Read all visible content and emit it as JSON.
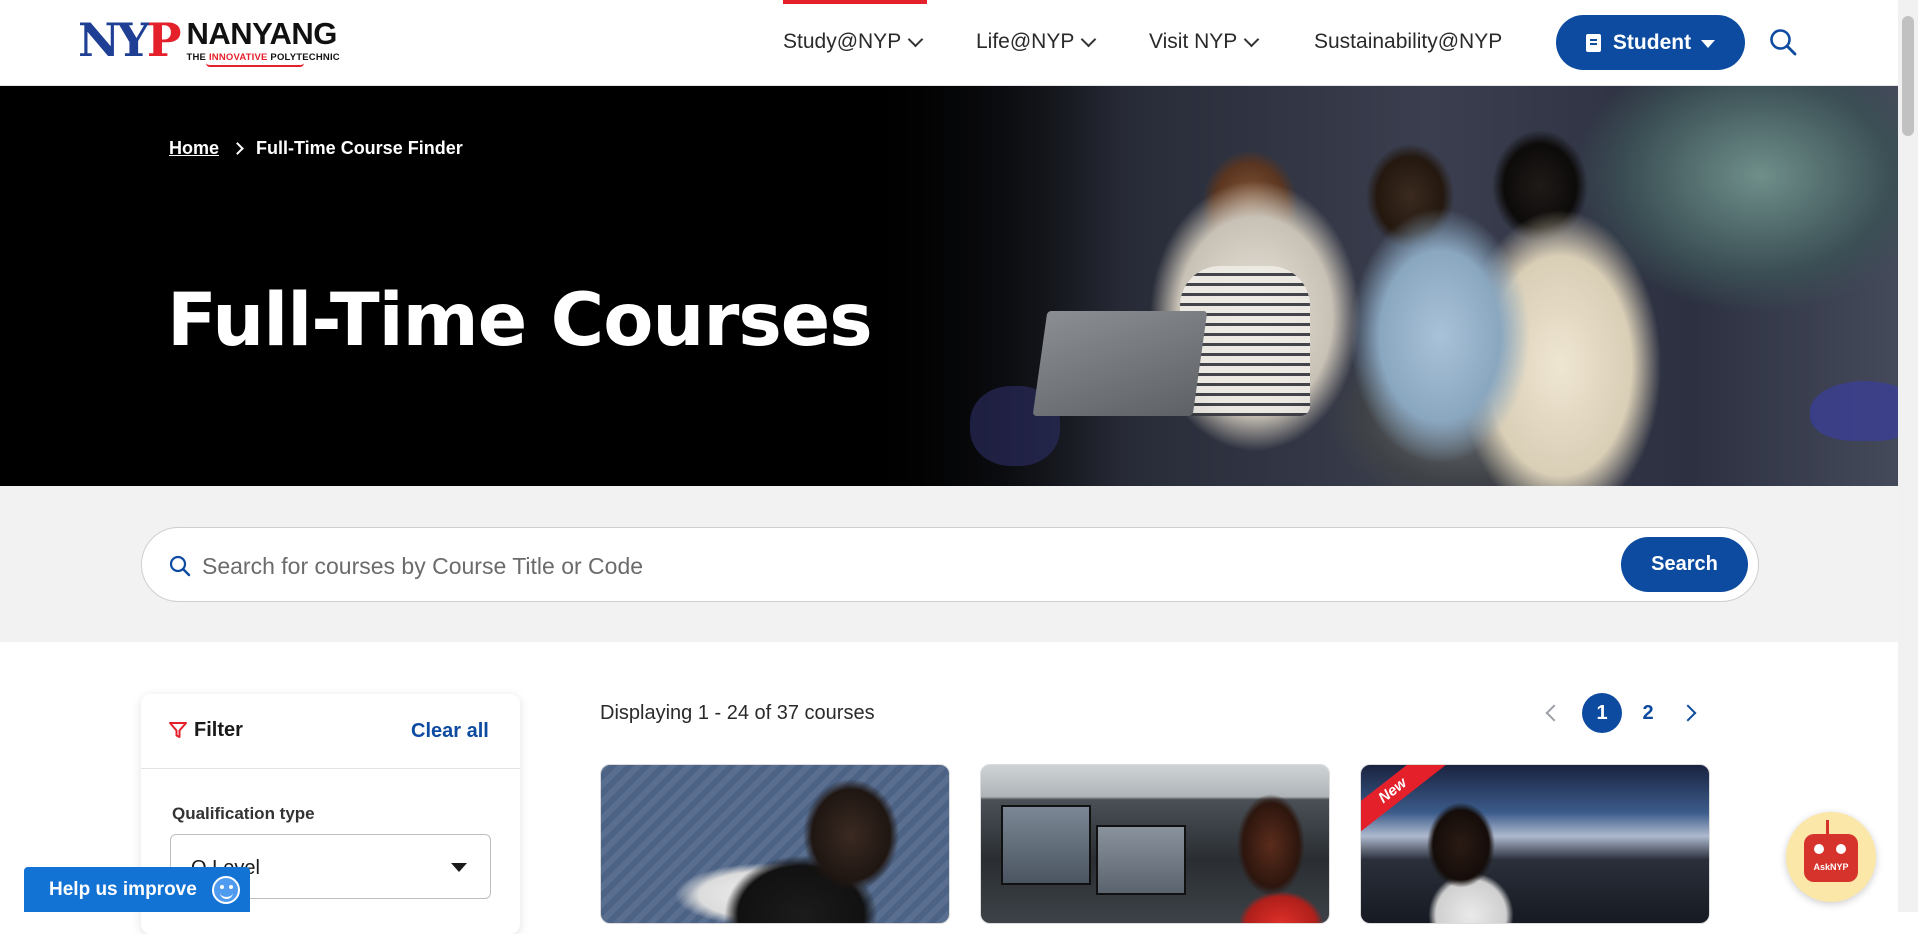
{
  "header": {
    "logo": {
      "mark": "NYP",
      "name": "NANYANG",
      "tagline_pre": "THE ",
      "tagline_hl": "INNOVATIVE",
      "tagline_post": " POLYTECHNIC"
    },
    "nav": [
      {
        "label": "Study@NYP",
        "has_dropdown": true,
        "active": true
      },
      {
        "label": "Life@NYP",
        "has_dropdown": true
      },
      {
        "label": "Visit NYP",
        "has_dropdown": true
      },
      {
        "label": "Sustainability@NYP",
        "has_dropdown": false
      }
    ],
    "student_button": "Student",
    "search_icon": "search-icon"
  },
  "hero": {
    "breadcrumb": {
      "home": "Home",
      "current": "Full-Time Course Finder"
    },
    "title": "Full-Time Courses"
  },
  "search": {
    "placeholder": "Search for courses by Course Title or Code",
    "button": "Search"
  },
  "filter": {
    "title": "Filter",
    "clear_all": "Clear all",
    "qualification_label": "Qualification type",
    "qualification_value": "O Level"
  },
  "results": {
    "count_text": "Displaying 1 - 24 of 37 courses",
    "pages": [
      "1",
      "2"
    ],
    "current_page": "1",
    "cards": [
      {
        "badge": ""
      },
      {
        "badge": ""
      },
      {
        "badge": "New"
      }
    ]
  },
  "help": {
    "label": "Help us improve"
  },
  "chatbot": {
    "label": "AskNYP"
  },
  "colors": {
    "brand_blue": "#0d4ba0",
    "brand_red": "#e4202b",
    "help_blue": "#1273d4"
  }
}
